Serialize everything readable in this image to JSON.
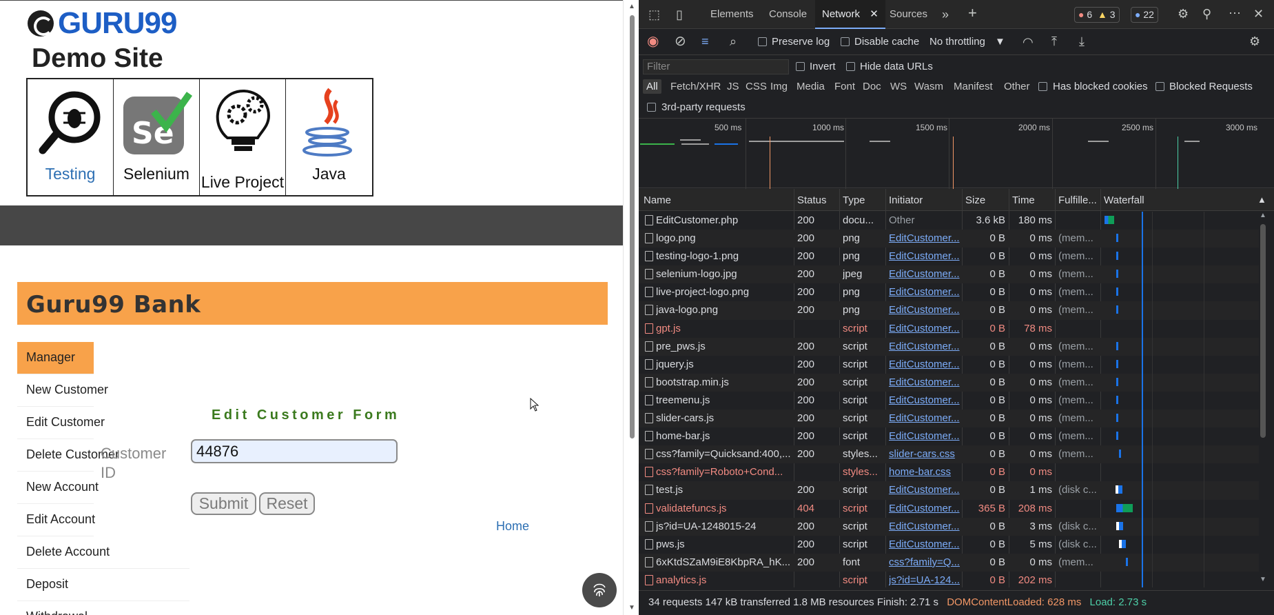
{
  "page": {
    "logo_text": "GURU99",
    "site_title": "Demo Site",
    "nav_boxes": [
      {
        "label": "Testing"
      },
      {
        "label": "Selenium"
      },
      {
        "label": "Live Project"
      },
      {
        "label": "Java"
      }
    ],
    "bank_title": "Guru99 Bank",
    "menu": [
      "Manager",
      "New Customer",
      "Edit Customer",
      "Delete Customer",
      "New Account",
      "Edit Account",
      "Delete Account",
      "Deposit",
      "Withdrawal"
    ],
    "form_title": "Edit Customer Form",
    "customer_id_label": "Customer ID",
    "customer_id_value": "44876",
    "submit_label": "Submit",
    "reset_label": "Reset",
    "home_label": "Home"
  },
  "devtools": {
    "tabs": [
      "Elements",
      "Console",
      "Network",
      "Sources"
    ],
    "active_tab": "Network",
    "errors": "6",
    "warnings": "3",
    "messages": "22",
    "preserve_log": "Preserve log",
    "disable_cache": "Disable cache",
    "throttling": "No throttling",
    "filter_placeholder": "Filter",
    "invert": "Invert",
    "hide_data_urls": "Hide data URLs",
    "type_filters": [
      "All",
      "Fetch/XHR",
      "JS",
      "CSS",
      "Img",
      "Media",
      "Font",
      "Doc",
      "WS",
      "Wasm",
      "Manifest",
      "Other"
    ],
    "has_blocked_cookies": "Has blocked cookies",
    "blocked_requests": "Blocked Requests",
    "third_party": "3rd-party requests",
    "timeline_ticks": [
      "500 ms",
      "1000 ms",
      "1500 ms",
      "2000 ms",
      "2500 ms",
      "3000 ms"
    ],
    "columns": [
      "Name",
      "Status",
      "Type",
      "Initiator",
      "Size",
      "Time",
      "Fulfille...",
      "Waterfall"
    ],
    "requests": [
      {
        "name": "EditCustomer.php",
        "status": "200",
        "type": "docu...",
        "initiator": "Other",
        "size": "3.6 kB",
        "time": "180 ms",
        "fulfilled": "",
        "error": false
      },
      {
        "name": "logo.png",
        "status": "200",
        "type": "png",
        "initiator": "EditCustomer...",
        "size": "0 B",
        "time": "0 ms",
        "fulfilled": "(mem...",
        "error": false
      },
      {
        "name": "testing-logo-1.png",
        "status": "200",
        "type": "png",
        "initiator": "EditCustomer...",
        "size": "0 B",
        "time": "0 ms",
        "fulfilled": "(mem...",
        "error": false
      },
      {
        "name": "selenium-logo.jpg",
        "status": "200",
        "type": "jpeg",
        "initiator": "EditCustomer...",
        "size": "0 B",
        "time": "0 ms",
        "fulfilled": "(mem...",
        "error": false
      },
      {
        "name": "live-project-logo.png",
        "status": "200",
        "type": "png",
        "initiator": "EditCustomer...",
        "size": "0 B",
        "time": "0 ms",
        "fulfilled": "(mem...",
        "error": false
      },
      {
        "name": "java-logo.png",
        "status": "200",
        "type": "png",
        "initiator": "EditCustomer...",
        "size": "0 B",
        "time": "0 ms",
        "fulfilled": "(mem...",
        "error": false
      },
      {
        "name": "gpt.js",
        "status": "",
        "type": "script",
        "initiator": "EditCustomer...",
        "size": "0 B",
        "time": "78 ms",
        "fulfilled": "",
        "error": true
      },
      {
        "name": "pre_pws.js",
        "status": "200",
        "type": "script",
        "initiator": "EditCustomer...",
        "size": "0 B",
        "time": "0 ms",
        "fulfilled": "(mem...",
        "error": false
      },
      {
        "name": "jquery.js",
        "status": "200",
        "type": "script",
        "initiator": "EditCustomer...",
        "size": "0 B",
        "time": "0 ms",
        "fulfilled": "(mem...",
        "error": false
      },
      {
        "name": "bootstrap.min.js",
        "status": "200",
        "type": "script",
        "initiator": "EditCustomer...",
        "size": "0 B",
        "time": "0 ms",
        "fulfilled": "(mem...",
        "error": false
      },
      {
        "name": "treemenu.js",
        "status": "200",
        "type": "script",
        "initiator": "EditCustomer...",
        "size": "0 B",
        "time": "0 ms",
        "fulfilled": "(mem...",
        "error": false
      },
      {
        "name": "slider-cars.js",
        "status": "200",
        "type": "script",
        "initiator": "EditCustomer...",
        "size": "0 B",
        "time": "0 ms",
        "fulfilled": "(mem...",
        "error": false
      },
      {
        "name": "home-bar.js",
        "status": "200",
        "type": "script",
        "initiator": "EditCustomer...",
        "size": "0 B",
        "time": "0 ms",
        "fulfilled": "(mem...",
        "error": false
      },
      {
        "name": "css?family=Quicksand:400,...",
        "status": "200",
        "type": "styles...",
        "initiator": "slider-cars.css",
        "size": "0 B",
        "time": "0 ms",
        "fulfilled": "(mem...",
        "error": false
      },
      {
        "name": "css?family=Roboto+Cond...",
        "status": "",
        "type": "styles...",
        "initiator": "home-bar.css",
        "size": "0 B",
        "time": "0 ms",
        "fulfilled": "",
        "error": true
      },
      {
        "name": "test.js",
        "status": "200",
        "type": "script",
        "initiator": "EditCustomer...",
        "size": "0 B",
        "time": "1 ms",
        "fulfilled": "(disk c...",
        "error": false
      },
      {
        "name": "validatefuncs.js",
        "status": "404",
        "type": "script",
        "initiator": "EditCustomer...",
        "size": "365 B",
        "time": "208 ms",
        "fulfilled": "",
        "error": true
      },
      {
        "name": "js?id=UA-1248015-24",
        "status": "200",
        "type": "script",
        "initiator": "EditCustomer...",
        "size": "0 B",
        "time": "3 ms",
        "fulfilled": "(disk c...",
        "error": false
      },
      {
        "name": "pws.js",
        "status": "200",
        "type": "script",
        "initiator": "EditCustomer...",
        "size": "0 B",
        "time": "5 ms",
        "fulfilled": "(disk c...",
        "error": false
      },
      {
        "name": "6xKtdSZaM9iE8KbpRA_hK...",
        "status": "200",
        "type": "font",
        "initiator": "css?family=Q...",
        "size": "0 B",
        "time": "0 ms",
        "fulfilled": "(mem...",
        "error": false
      },
      {
        "name": "analytics.js",
        "status": "",
        "type": "script",
        "initiator": "js?id=UA-124...",
        "size": "0 B",
        "time": "202 ms",
        "fulfilled": "",
        "error": true
      }
    ],
    "status_bar": {
      "summary": "34 requests   147 kB transferred   1.8 MB resources   Finish: 2.71 s",
      "dom_content_loaded": "DOMContentLoaded: 628 ms",
      "load": "Load: 2.73 s"
    }
  }
}
